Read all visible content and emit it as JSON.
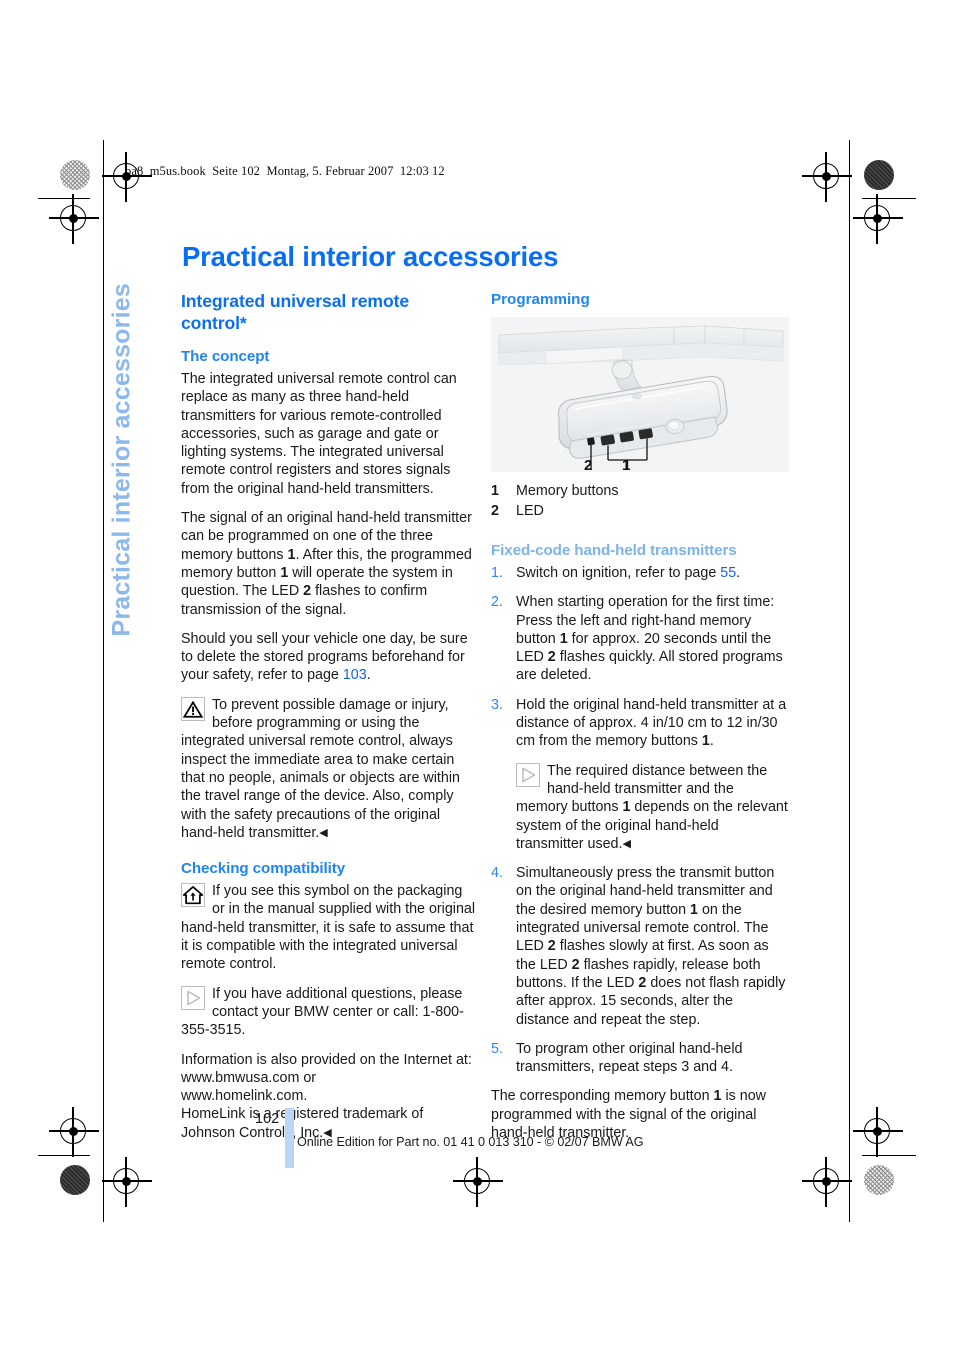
{
  "print_marks": {
    "file_line": "ba8_m5us.book  Seite 102  Montag, 5. Februar 2007  12:03 12"
  },
  "side_tab": {
    "label": "Practical interior accessories"
  },
  "page_title": "Practical interior accessories",
  "left_column": {
    "section_heading": "Integrated universal remote control*",
    "concept": {
      "heading": "The concept",
      "p1": "The integrated universal remote control can replace as many as three hand-held transmitters for various remote-controlled accessories, such as garage and gate or lighting systems. The integrated universal remote control registers and stores signals from the original hand-held transmitters.",
      "p2_a": "The signal of an original hand-held transmitter can be programmed on one of the three memory buttons ",
      "p2_b1": "1",
      "p2_c": ". After this, the programmed memory button ",
      "p2_b2": "1",
      "p2_d": " will operate the system in question. The LED ",
      "p2_b3": "2",
      "p2_e": " flashes to confirm transmission of the signal.",
      "p3_a": "Should you sell your vehicle one day, be sure to delete the stored programs beforehand for your safety, refer to page ",
      "p3_ref": "103",
      "p3_b": "."
    },
    "warning_note": {
      "icon": "warning-triangle-icon",
      "text": "To prevent possible damage or injury, before programming or using the integrated universal remote control, always inspect the immediate area to make certain that no people, animals or objects are within the travel range of the device. Also, comply with the safety precautions of the original hand-held transmitter.",
      "endmark": "◀"
    },
    "compatibility": {
      "heading": "Checking compatibility",
      "icon": "homelink-house-icon",
      "p1": "If you see this symbol on the packaging or in the manual supplied with the original hand-held transmitter, it is safe to assume that it is compatible with the integrated universal remote control.",
      "info_icon": "info-triangle-icon",
      "p2": "If you have additional questions, please contact your BMW center or call: 1-800-355-3515.",
      "p3": "Information is also provided on the Internet at:",
      "p4": "www.bmwusa.com or",
      "p5": "www.homelink.com.",
      "p6": "HomeLink is a registered trademark of Johnson Controls, Inc.",
      "endmark": "◀"
    }
  },
  "right_column": {
    "programming_heading": "Programming",
    "figure": {
      "alt": "rear-view mirror with three memory buttons and an LED",
      "callout_left": "2",
      "callout_right": "1",
      "code": ""
    },
    "legend": [
      {
        "num": "1",
        "label": "Memory buttons"
      },
      {
        "num": "2",
        "label": "LED"
      }
    ],
    "fixed_code": {
      "heading": "Fixed-code hand-held transmitters",
      "steps": [
        {
          "num": "1.",
          "a": "Switch on ignition, refer to page ",
          "ref": "55",
          "b": "."
        },
        {
          "num": "2.",
          "a": "When starting operation for the first time: Press the left and right-hand memory button ",
          "bold1": "1",
          "b": " for approx. 20 seconds until the LED ",
          "bold2": "2",
          "c": " flashes quickly. All stored programs are deleted."
        },
        {
          "num": "3.",
          "a": "Hold the original hand-held transmitter at a distance of approx. 4 in/10 cm to 12 in/30 cm from the memory buttons ",
          "bold1": "1",
          "b": ".",
          "substep": {
            "icon": "info-triangle-icon",
            "a": "The required distance between the hand-held transmitter and the memory buttons ",
            "bold1": "1",
            "b": " depends on the relevant system of the original hand-held transmitter used.",
            "endmark": "◀"
          }
        },
        {
          "num": "4.",
          "a": "Simultaneously press the transmit button on the original hand-held transmitter and the desired memory button ",
          "bold1": "1",
          "b": " on the integrated universal remote control. The LED ",
          "bold2": "2",
          "c": " flashes slowly at first. As soon as the LED ",
          "bold3": "2",
          "d": " flashes rapidly, release both buttons. If the LED ",
          "bold4": "2",
          "e": " does not flash rapidly after approx. 15 seconds, alter the distance and repeat the step."
        },
        {
          "num": "5.",
          "a": "To program other original hand-held transmitters, repeat steps 3 and 4."
        }
      ],
      "closing_a": "The corresponding memory button ",
      "closing_bold": "1",
      "closing_b": " is now programmed with the signal of the original hand-held transmitter."
    }
  },
  "footer": {
    "folio": "102",
    "copyright": "Online Edition for Part no. 01 41 0 013 310 - © 02/07 BMW AG"
  },
  "colors": {
    "title_blue": "#0a6ef0",
    "subheading_blue": "#1f85f0",
    "pale_blue": "#7db3e8",
    "side_tab_blue": "#8cb8ec",
    "xref_blue": "#1464d8",
    "folio_bar": "#b9d7f5"
  }
}
